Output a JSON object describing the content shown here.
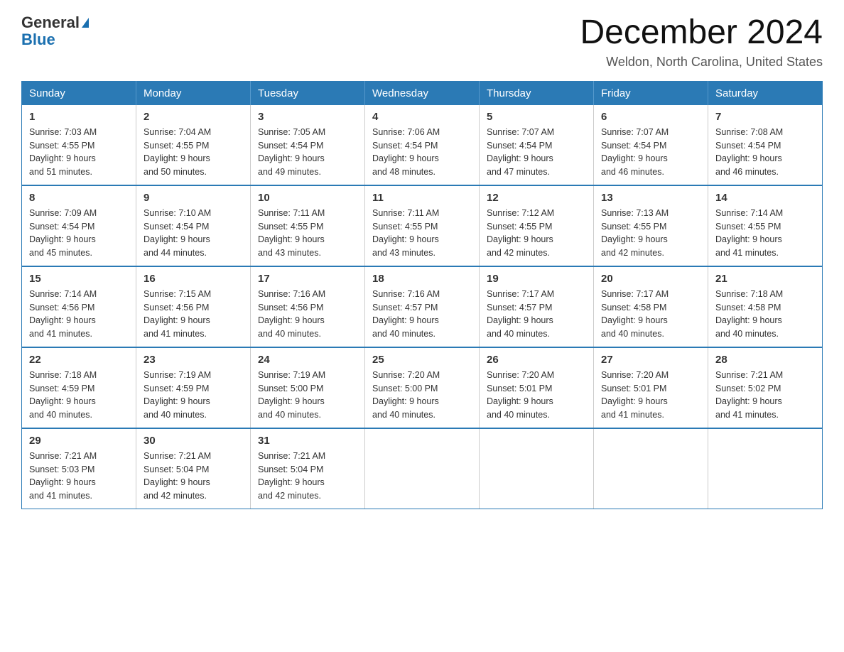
{
  "logo": {
    "general": "General",
    "blue": "Blue"
  },
  "header": {
    "month": "December 2024",
    "location": "Weldon, North Carolina, United States"
  },
  "weekdays": [
    "Sunday",
    "Monday",
    "Tuesday",
    "Wednesday",
    "Thursday",
    "Friday",
    "Saturday"
  ],
  "weeks": [
    [
      {
        "day": "1",
        "sunrise": "7:03 AM",
        "sunset": "4:55 PM",
        "daylight": "9 hours and 51 minutes."
      },
      {
        "day": "2",
        "sunrise": "7:04 AM",
        "sunset": "4:55 PM",
        "daylight": "9 hours and 50 minutes."
      },
      {
        "day": "3",
        "sunrise": "7:05 AM",
        "sunset": "4:54 PM",
        "daylight": "9 hours and 49 minutes."
      },
      {
        "day": "4",
        "sunrise": "7:06 AM",
        "sunset": "4:54 PM",
        "daylight": "9 hours and 48 minutes."
      },
      {
        "day": "5",
        "sunrise": "7:07 AM",
        "sunset": "4:54 PM",
        "daylight": "9 hours and 47 minutes."
      },
      {
        "day": "6",
        "sunrise": "7:07 AM",
        "sunset": "4:54 PM",
        "daylight": "9 hours and 46 minutes."
      },
      {
        "day": "7",
        "sunrise": "7:08 AM",
        "sunset": "4:54 PM",
        "daylight": "9 hours and 46 minutes."
      }
    ],
    [
      {
        "day": "8",
        "sunrise": "7:09 AM",
        "sunset": "4:54 PM",
        "daylight": "9 hours and 45 minutes."
      },
      {
        "day": "9",
        "sunrise": "7:10 AM",
        "sunset": "4:54 PM",
        "daylight": "9 hours and 44 minutes."
      },
      {
        "day": "10",
        "sunrise": "7:11 AM",
        "sunset": "4:55 PM",
        "daylight": "9 hours and 43 minutes."
      },
      {
        "day": "11",
        "sunrise": "7:11 AM",
        "sunset": "4:55 PM",
        "daylight": "9 hours and 43 minutes."
      },
      {
        "day": "12",
        "sunrise": "7:12 AM",
        "sunset": "4:55 PM",
        "daylight": "9 hours and 42 minutes."
      },
      {
        "day": "13",
        "sunrise": "7:13 AM",
        "sunset": "4:55 PM",
        "daylight": "9 hours and 42 minutes."
      },
      {
        "day": "14",
        "sunrise": "7:14 AM",
        "sunset": "4:55 PM",
        "daylight": "9 hours and 41 minutes."
      }
    ],
    [
      {
        "day": "15",
        "sunrise": "7:14 AM",
        "sunset": "4:56 PM",
        "daylight": "9 hours and 41 minutes."
      },
      {
        "day": "16",
        "sunrise": "7:15 AM",
        "sunset": "4:56 PM",
        "daylight": "9 hours and 41 minutes."
      },
      {
        "day": "17",
        "sunrise": "7:16 AM",
        "sunset": "4:56 PM",
        "daylight": "9 hours and 40 minutes."
      },
      {
        "day": "18",
        "sunrise": "7:16 AM",
        "sunset": "4:57 PM",
        "daylight": "9 hours and 40 minutes."
      },
      {
        "day": "19",
        "sunrise": "7:17 AM",
        "sunset": "4:57 PM",
        "daylight": "9 hours and 40 minutes."
      },
      {
        "day": "20",
        "sunrise": "7:17 AM",
        "sunset": "4:58 PM",
        "daylight": "9 hours and 40 minutes."
      },
      {
        "day": "21",
        "sunrise": "7:18 AM",
        "sunset": "4:58 PM",
        "daylight": "9 hours and 40 minutes."
      }
    ],
    [
      {
        "day": "22",
        "sunrise": "7:18 AM",
        "sunset": "4:59 PM",
        "daylight": "9 hours and 40 minutes."
      },
      {
        "day": "23",
        "sunrise": "7:19 AM",
        "sunset": "4:59 PM",
        "daylight": "9 hours and 40 minutes."
      },
      {
        "day": "24",
        "sunrise": "7:19 AM",
        "sunset": "5:00 PM",
        "daylight": "9 hours and 40 minutes."
      },
      {
        "day": "25",
        "sunrise": "7:20 AM",
        "sunset": "5:00 PM",
        "daylight": "9 hours and 40 minutes."
      },
      {
        "day": "26",
        "sunrise": "7:20 AM",
        "sunset": "5:01 PM",
        "daylight": "9 hours and 40 minutes."
      },
      {
        "day": "27",
        "sunrise": "7:20 AM",
        "sunset": "5:01 PM",
        "daylight": "9 hours and 41 minutes."
      },
      {
        "day": "28",
        "sunrise": "7:21 AM",
        "sunset": "5:02 PM",
        "daylight": "9 hours and 41 minutes."
      }
    ],
    [
      {
        "day": "29",
        "sunrise": "7:21 AM",
        "sunset": "5:03 PM",
        "daylight": "9 hours and 41 minutes."
      },
      {
        "day": "30",
        "sunrise": "7:21 AM",
        "sunset": "5:04 PM",
        "daylight": "9 hours and 42 minutes."
      },
      {
        "day": "31",
        "sunrise": "7:21 AM",
        "sunset": "5:04 PM",
        "daylight": "9 hours and 42 minutes."
      },
      null,
      null,
      null,
      null
    ]
  ],
  "labels": {
    "sunrise": "Sunrise:",
    "sunset": "Sunset:",
    "daylight": "Daylight:"
  }
}
